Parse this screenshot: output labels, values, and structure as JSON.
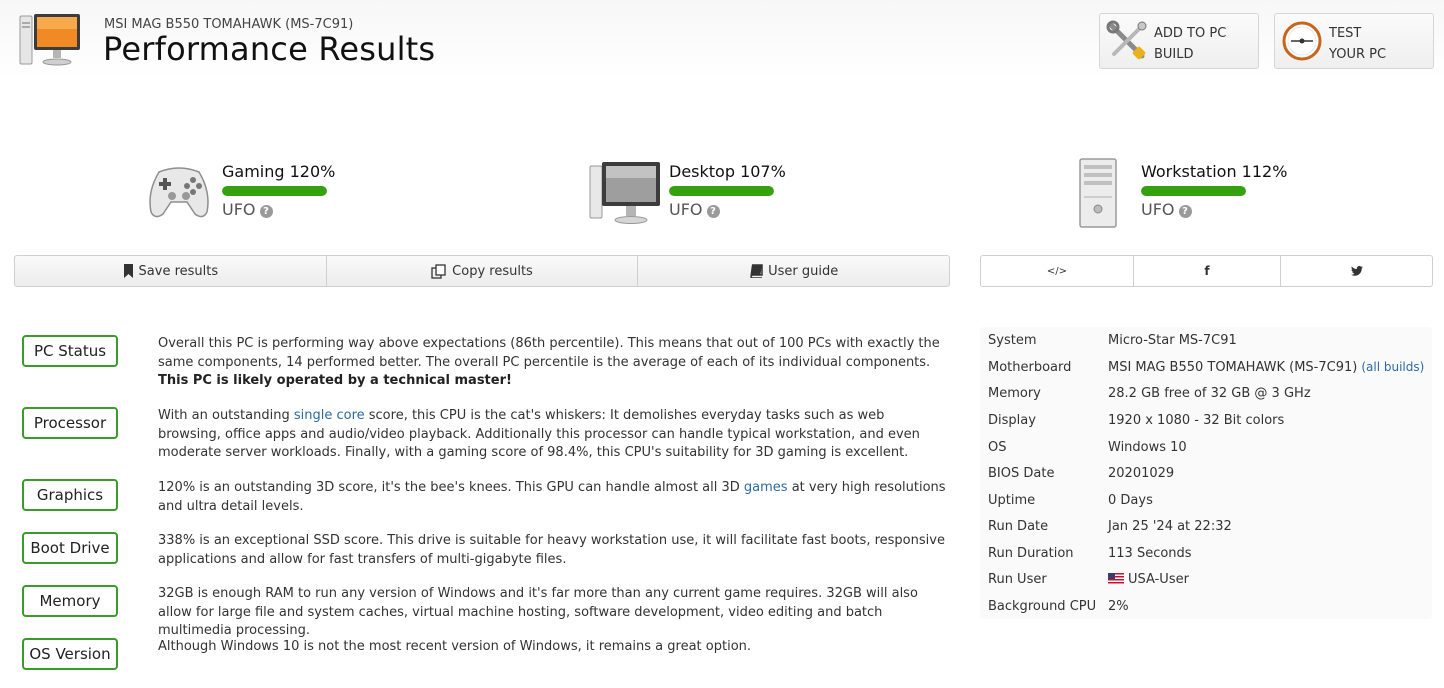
{
  "header": {
    "subtitle": "MSI MAG B550 TOMAHAWK (MS-7C91)",
    "title": "Performance Results",
    "add_line1": "ADD TO PC",
    "add_line2": "BUILD",
    "test_line1": "TEST",
    "test_line2": "YOUR PC"
  },
  "scores": [
    {
      "name": "Gaming 120%",
      "rating": "UFO",
      "fill_percent": 100,
      "icon": "gamepad-icon"
    },
    {
      "name": "Desktop 107%",
      "rating": "UFO",
      "fill_percent": 100,
      "icon": "desktop-icon"
    },
    {
      "name": "Workstation 112%",
      "rating": "UFO",
      "fill_percent": 100,
      "icon": "workstation-icon"
    }
  ],
  "actions": {
    "save": "Save results",
    "copy": "Copy results",
    "guide": "User guide"
  },
  "share": {
    "embed": "</>",
    "facebook": "f"
  },
  "status": [
    {
      "label": "PC Status"
    },
    {
      "label": "Processor"
    },
    {
      "label": "Graphics"
    },
    {
      "label": "Boot Drive"
    },
    {
      "label": "Memory"
    },
    {
      "label": "OS Version"
    }
  ],
  "desc": {
    "pc_1": "Overall this PC is performing way above expectations (86th percentile). This means that out of 100 PCs with exactly the same components, 14 performed better. The overall PC percentile is the average of each of its individual components. ",
    "pc_bold": "This PC is likely operated by a technical master!",
    "proc_1": "With an outstanding ",
    "proc_link": "single core",
    "proc_2": " score, this CPU is the cat's whiskers: It demolishes everyday tasks such as web browsing, office apps and audio/video playback. Additionally this processor can handle typical workstation, and even moderate server workloads. Finally, with a gaming score of 98.4%, this CPU's suitability for 3D gaming is excellent.",
    "gfx_1": "120% is an outstanding 3D score, it's the bee's knees. This GPU can handle almost all 3D ",
    "gfx_link": "games",
    "gfx_2": " at very high resolutions and ultra detail levels.",
    "boot": "338% is an exceptional SSD score. This drive is suitable for heavy workstation use, it will facilitate fast boots, responsive applications and allow for fast transfers of multi-gigabyte files.",
    "mem": "32GB is enough RAM to run any version of Windows and it's far more than any current game requires. 32GB will also allow for large file and system caches, virtual machine hosting, software development, video editing and batch multimedia processing.",
    "os": "Although Windows 10 is not the most recent version of Windows, it remains a great option."
  },
  "info": [
    {
      "k": "System",
      "v": "Micro-Star MS-7C91"
    },
    {
      "k": "Motherboard",
      "v": "MSI MAG B550 TOMAHAWK (MS-7C91)",
      "link": "(all builds)"
    },
    {
      "k": "Memory",
      "v": "28.2 GB free of 32 GB @ 3 GHz"
    },
    {
      "k": "Display",
      "v": "1920 x 1080 - 32 Bit colors"
    },
    {
      "k": "OS",
      "v": "Windows 10"
    },
    {
      "k": "BIOS Date",
      "v": "20201029"
    },
    {
      "k": "Uptime",
      "v": "0 Days"
    },
    {
      "k": "Run Date",
      "v": "Jan 25 '24 at 22:32"
    },
    {
      "k": "Run Duration",
      "v": "113 Seconds"
    },
    {
      "k": "Run User",
      "v": "USA-User"
    },
    {
      "k": "Background CPU",
      "v": "2%"
    }
  ],
  "colors": {
    "accent_green": "#35a10e",
    "badge_border": "#3a9a2a",
    "link": "#2b6aa3"
  }
}
